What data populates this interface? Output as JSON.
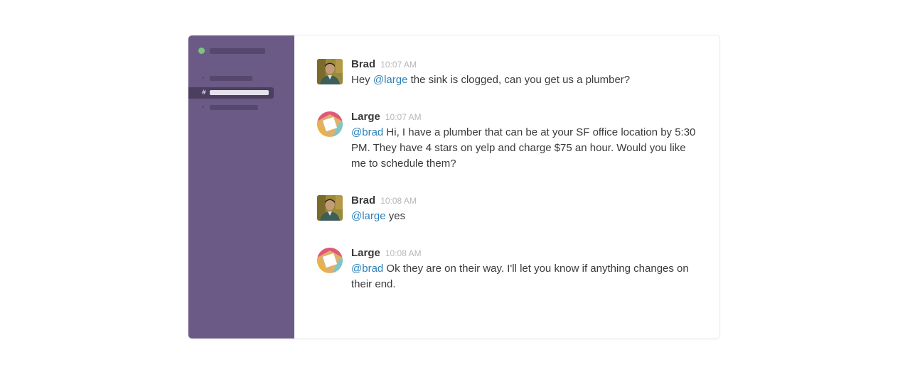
{
  "colors": {
    "sidebar_bg": "#6b5a86",
    "sidebar_active": "#4c3e5f",
    "online": "#7ac77a",
    "mention": "#2a80b9",
    "text": "#3a3a3d",
    "timestamp": "#b7b7ba"
  },
  "sidebar": {
    "channels": [
      {
        "icon": "•",
        "active": false
      },
      {
        "icon": "#",
        "active": true
      },
      {
        "icon": "•",
        "active": false
      }
    ]
  },
  "messages": [
    {
      "sender": "Brad",
      "time": "10:07 AM",
      "avatar": "user-photo-avatar",
      "mention": "@large",
      "text": "the sink is clogged, can you get us a plumber?",
      "prefix": "Hey "
    },
    {
      "sender": "Large",
      "time": "10:07 AM",
      "avatar": "large-logo-avatar",
      "mention": "@brad",
      "text": "Hi, I have a plumber that can be at your SF office location by 5:30 PM. They have 4 stars on yelp and charge $75 an hour. Would you like me to schedule them?"
    },
    {
      "sender": "Brad",
      "time": "10:08 AM",
      "avatar": "user-photo-avatar",
      "mention": "@large",
      "text": "yes"
    },
    {
      "sender": "Large",
      "time": "10:08 AM",
      "avatar": "large-logo-avatar",
      "mention": "@brad",
      "text": "Ok they are on their way. I'll let you know if anything changes on their end."
    }
  ]
}
